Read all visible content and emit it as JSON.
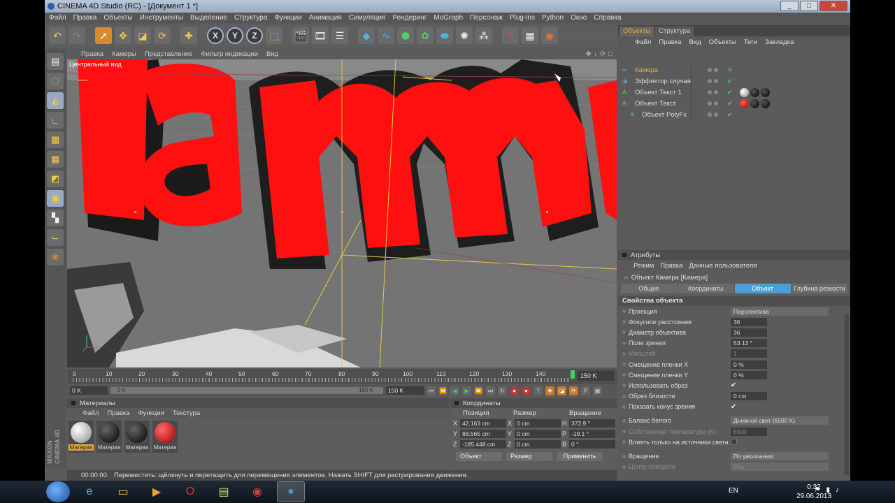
{
  "window": {
    "title": "CINEMA 4D Studio (RC) - [Документ 1 *]",
    "buttons": {
      "minimize": "_",
      "maximize": "□",
      "close": "✕"
    }
  },
  "menubar": [
    "Файл",
    "Правка",
    "Объекты",
    "Инструменты",
    "Выделение",
    "Структура",
    "Функции",
    "Анимация",
    "Симуляция",
    "Рендеринг",
    "MoGraph",
    "Персонаж",
    "Plug-ins",
    "Python",
    "Окно",
    "Справка"
  ],
  "toolbar": {
    "x_axis": "X",
    "y_axis": "Y",
    "z_axis": "Z"
  },
  "viewport": {
    "menu": [
      "Правка",
      "Камеры",
      "Представление",
      "Фильтр индикации",
      "Вид"
    ],
    "label": "Центральный вид",
    "icons": [
      "✥",
      "↓",
      "⟳",
      "□"
    ]
  },
  "timeline": {
    "ticks": [
      "0",
      "10",
      "20",
      "30",
      "40",
      "50",
      "60",
      "70",
      "80",
      "90",
      "100",
      "110",
      "120",
      "130",
      "140"
    ],
    "end_frame": "150 K",
    "marker_frame": 150
  },
  "transport": {
    "current": "0 K",
    "slider_start": "0 K",
    "slider_end": "150 K",
    "max": "150 K"
  },
  "materials": {
    "title": "Материалы",
    "menu": [
      "Файл",
      "Правка",
      "Функции",
      "Текстура"
    ],
    "items": [
      {
        "label": "Материа",
        "color": "white",
        "selected": true
      },
      {
        "label": "Материа",
        "color": "black",
        "selected": false
      },
      {
        "label": "Материа",
        "color": "black",
        "selected": false
      },
      {
        "label": "Материа",
        "color": "red",
        "selected": false
      }
    ]
  },
  "coordinates": {
    "title": "Координаты",
    "headers": {
      "position": "Позиция",
      "size": "Размер",
      "rotation": "Вращение"
    },
    "rows": [
      {
        "ax": "X",
        "pos": "42.163 cm",
        "sax": "X",
        "size": "0 cm",
        "rax": "H",
        "rot": "372.9 °"
      },
      {
        "ax": "Y",
        "pos": "88.565 cm",
        "sax": "Y",
        "size": "0 cm",
        "rax": "P",
        "rot": "-19.1 °"
      },
      {
        "ax": "Z",
        "pos": "-185.448 cm",
        "sax": "Z",
        "size": "0 cm",
        "rax": "B",
        "rot": "0 °"
      }
    ],
    "mode_select": "Объект",
    "size_select": "Размер",
    "apply": "Применить"
  },
  "statusbar": {
    "time": "00:00:00",
    "message": "Переместить: щёлкнуть и перетащить для перемещения элементов. Нажать SHIFT для растрирования движения."
  },
  "objects_panel": {
    "tabs": [
      "Объекты",
      "Структура"
    ],
    "menu": [
      "Файл",
      "Правка",
      "Вид",
      "Объекты",
      "Теги",
      "Закладка"
    ],
    "items": [
      {
        "name": "Камера",
        "icon": "camera-icon",
        "highlight": true,
        "tags": []
      },
      {
        "name": "Эффектор случая",
        "icon": "effector-icon",
        "highlight": false,
        "tags": []
      },
      {
        "name": "Объект Текст 1",
        "icon": "text-object-icon",
        "highlight": false,
        "tags": [
          "white",
          "black",
          "black"
        ]
      },
      {
        "name": "Объект Текст",
        "icon": "text-object-icon",
        "highlight": false,
        "tags": [
          "red",
          "black",
          "black"
        ]
      },
      {
        "name": "Объект PolyFx",
        "icon": "polyfx-icon",
        "highlight": false,
        "tags": []
      }
    ]
  },
  "attributes": {
    "title": "Атрибуты",
    "menu": [
      "Режим",
      "Правка",
      "Данные пользователя"
    ],
    "object_label": "Объект Камера [Камера]",
    "tabs": [
      "Общие",
      "Координаты",
      "Объект",
      "Глубина резкости"
    ],
    "active_tab": 2,
    "section": "Свойства объекта",
    "props": [
      {
        "label": "Проекция",
        "value": "Перспектива",
        "kind": "select"
      },
      {
        "label": "Фокусное расстояние",
        "value": "36",
        "kind": "num"
      },
      {
        "label": "Диаметр объектива",
        "value": "36",
        "kind": "num"
      },
      {
        "label": "Поле зрения",
        "value": "53.13 °",
        "kind": "num"
      },
      {
        "label": "Масштаб",
        "value": "1",
        "kind": "num",
        "disabled": true
      },
      {
        "label": "Смещение пленки X",
        "value": "0 %",
        "kind": "num"
      },
      {
        "label": "Смещение пленки Y",
        "value": "0 %",
        "kind": "num"
      },
      {
        "label": "Использовать обрез",
        "value": "✔",
        "kind": "check"
      },
      {
        "label": "Обрез близости",
        "value": "0 cm",
        "kind": "num"
      },
      {
        "label": "Показать конус зрения",
        "value": "✔",
        "kind": "check"
      },
      {
        "label": "Баланс белого",
        "value": "Дневной свет (6500 K)",
        "kind": "select",
        "gap": true
      },
      {
        "label": "Собственная температура (K)",
        "value": "6500",
        "kind": "num",
        "disabled": true
      },
      {
        "label": "Влиять только на источники света",
        "value": "",
        "kind": "box"
      },
      {
        "label": "Вращение",
        "value": "По умолчанию",
        "kind": "select",
        "gap": true
      },
      {
        "label": "Центр поворота",
        "value": "Ось",
        "kind": "select",
        "disabled": true
      }
    ]
  },
  "taskbar": {
    "lang": "EN",
    "time": "0:32",
    "date": "29.06.2013"
  },
  "colors": {
    "accent_orange": "#e8a23a",
    "active_tab_blue": "#4aa0d4",
    "text_red": "#ff0000"
  }
}
